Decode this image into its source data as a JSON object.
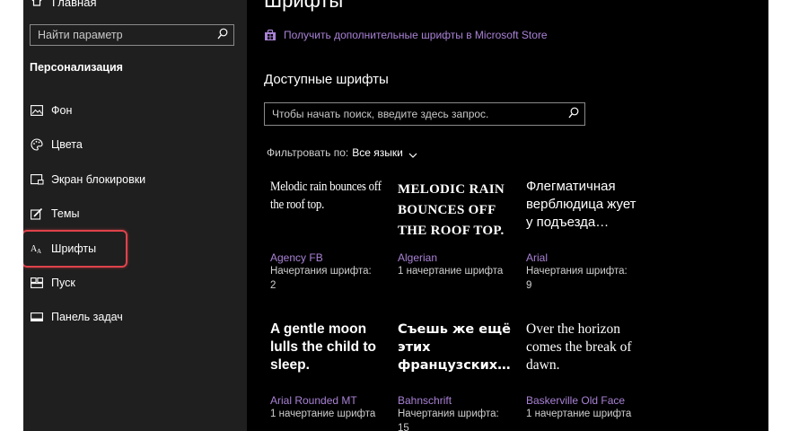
{
  "sidebar": {
    "home_label": "Главная",
    "search_placeholder": "Найти параметр",
    "section_title": "Персонализация",
    "items": [
      {
        "label": "Фон",
        "icon": "picture-icon"
      },
      {
        "label": "Цвета",
        "icon": "palette-icon"
      },
      {
        "label": "Экран блокировки",
        "icon": "lock-screen-icon"
      },
      {
        "label": "Темы",
        "icon": "brush-icon"
      },
      {
        "label": "Шрифты",
        "icon": "font-icon"
      },
      {
        "label": "Пуск",
        "icon": "start-icon"
      },
      {
        "label": "Панель задач",
        "icon": "taskbar-icon"
      }
    ],
    "selected_item": "Шрифты"
  },
  "main": {
    "title": "Шрифты",
    "store_link": "Получить дополнительные шрифты в Microsoft Store",
    "available_heading": "Доступные шрифты",
    "search_placeholder": "Чтобы начать поиск, введите здесь запрос.",
    "filter_label": "Фильтровать по:",
    "filter_value": "Все языки",
    "fonts": [
      {
        "sample": "Melodic rain bounces off the roof top.",
        "name": "Agency FB",
        "faces_label": "Начертания шрифта:",
        "faces_count": "2"
      },
      {
        "sample": "MELODIC RAIN BOUNCES OFF THE ROOF TOP.",
        "name": "Algerian",
        "faces_label": "1 начертание шрифта",
        "faces_count": ""
      },
      {
        "sample": "Флегматичная верблюдица жует у подъезда…",
        "name": "Arial",
        "faces_label": "Начертания шрифта:",
        "faces_count": "9"
      },
      {
        "sample": "A gentle moon lulls the child to sleep.",
        "name": "Arial Rounded MT",
        "faces_label": "1 начертание шрифта",
        "faces_count": ""
      },
      {
        "sample": "Съешь же ещё этих французских…",
        "name": "Bahnschrift",
        "faces_label": "Начертания шрифта:",
        "faces_count": "15"
      },
      {
        "sample": "Over the horizon comes the break of dawn.",
        "name": "Baskerville Old Face",
        "faces_label": "1 начертание шрифта",
        "faces_count": ""
      }
    ]
  },
  "colors": {
    "accent": "#a982d6",
    "highlight": "#e0434b",
    "sidebar_bg": "#1f1f1f",
    "main_bg": "#000000"
  }
}
